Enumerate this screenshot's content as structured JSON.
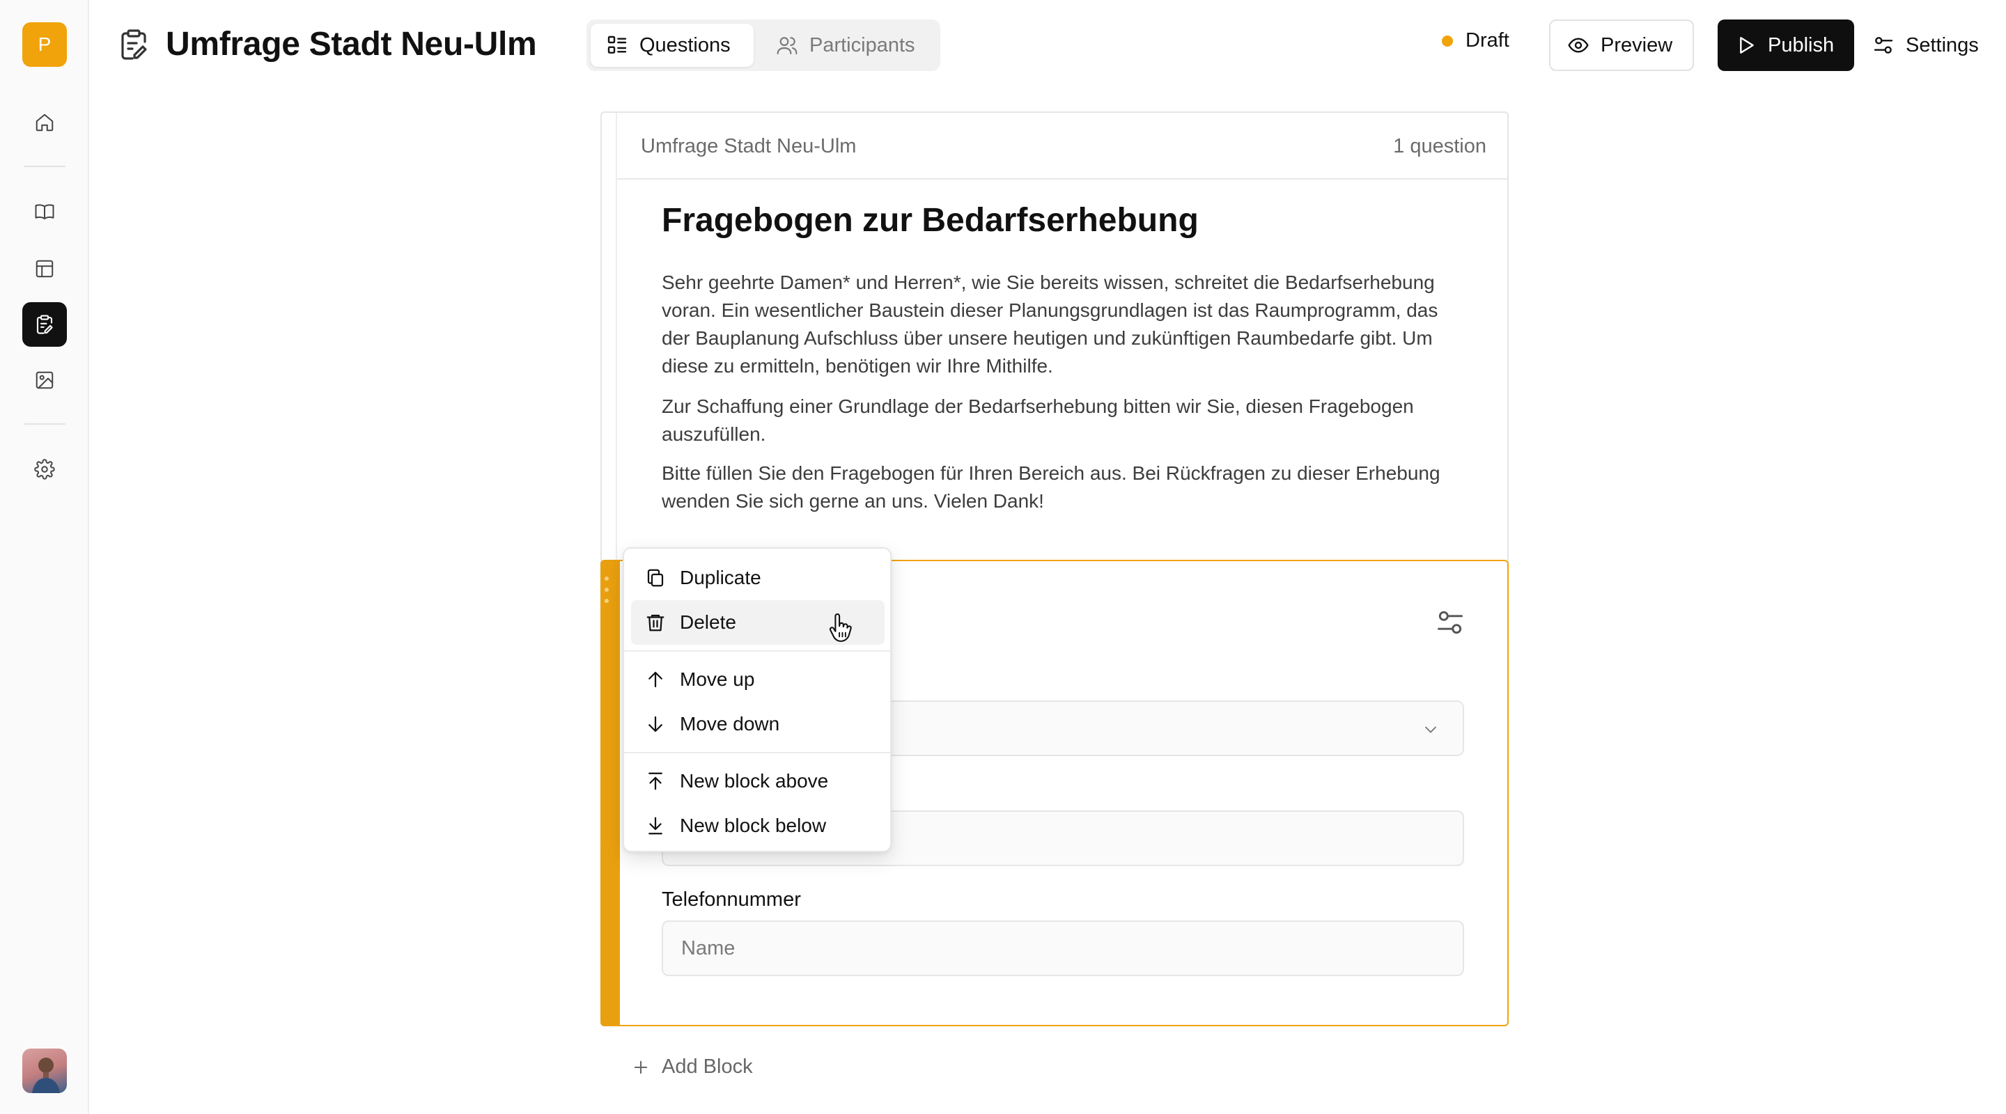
{
  "sidebar": {
    "logo_letter": "P",
    "items": [
      {
        "name": "home",
        "icon": "home-icon",
        "active": false
      },
      {
        "name": "library",
        "icon": "book-icon",
        "active": false
      },
      {
        "name": "table",
        "icon": "table-icon",
        "active": false
      },
      {
        "name": "surveys",
        "icon": "clipboard-icon",
        "active": true
      },
      {
        "name": "media",
        "icon": "image-icon",
        "active": false
      },
      {
        "name": "settings",
        "icon": "gear-icon",
        "active": false
      }
    ]
  },
  "header": {
    "title": "Umfrage Stadt Neu-Ulm",
    "tabs": [
      {
        "label": "Questions",
        "icon": "list-icon",
        "active": true
      },
      {
        "label": "Participants",
        "icon": "users-icon",
        "active": false
      }
    ],
    "status": {
      "label": "Draft",
      "color": "#f0a30a"
    },
    "preview_label": "Preview",
    "publish_label": "Publish",
    "settings_label": "Settings"
  },
  "survey": {
    "name": "Umfrage Stadt Neu-Ulm",
    "question_count": "1 question",
    "intro_title": "Fragebogen zur Bedarfserhebung",
    "intro_paragraphs": [
      "Sehr geehrte Damen* und Herren*, wie Sie bereits wissen, schreitet die Bedarfserhebung voran. Ein wesentlicher Baustein dieser Planungsgrundlagen ist das Raumprogramm, das der Bauplanung Aufschluss über unsere heutigen und zukünftigen Raumbedarfe gibt. Um diese zu ermitteln, benötigen wir Ihre Mithilfe.",
      "Zur Schaffung einer Grundlage der Bedarfserhebung bitten wir Sie, diesen Fragebogen auszufüllen.",
      "Bitte füllen Sie den Fragebogen für Ihren Bereich aus. Bei Rückfragen zu dieser Erhebung wenden Sie sich gerne an uns. Vielen Dank!"
    ],
    "block": {
      "accent_color": "#e9a010",
      "field_label": "Telefonnummer",
      "field_placeholder": "Name"
    },
    "add_block_label": "Add Block"
  },
  "context_menu": {
    "items": [
      {
        "label": "Duplicate",
        "icon": "copy-icon"
      },
      {
        "label": "Delete",
        "icon": "trash-icon",
        "hovered": true
      },
      {
        "label": "Move up",
        "icon": "arrow-up-icon"
      },
      {
        "label": "Move down",
        "icon": "arrow-down-icon"
      },
      {
        "label": "New block above",
        "icon": "arrow-up-to-line-icon"
      },
      {
        "label": "New block below",
        "icon": "arrow-down-to-line-icon"
      }
    ]
  }
}
